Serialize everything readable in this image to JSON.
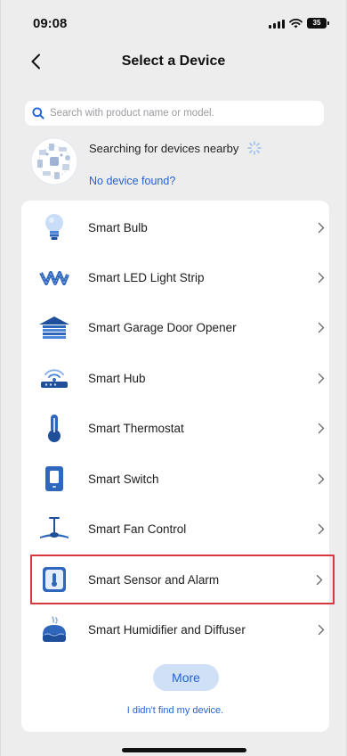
{
  "status_bar": {
    "time": "09:08",
    "battery": "35"
  },
  "nav": {
    "title": "Select a Device",
    "back_icon": "chevron-left-icon"
  },
  "search": {
    "placeholder": "Search with product name or model."
  },
  "nearby": {
    "status": "Searching for devices nearby",
    "not_found_link": "No device found?"
  },
  "devices": [
    {
      "label": "Smart Bulb",
      "icon": "bulb-icon"
    },
    {
      "label": "Smart LED Light Strip",
      "icon": "light-strip-icon"
    },
    {
      "label": "Smart Garage Door Opener",
      "icon": "garage-door-icon"
    },
    {
      "label": "Smart Hub",
      "icon": "hub-icon"
    },
    {
      "label": "Smart Thermostat",
      "icon": "thermostat-icon"
    },
    {
      "label": "Smart Switch",
      "icon": "switch-icon"
    },
    {
      "label": "Smart Fan Control",
      "icon": "fan-icon"
    },
    {
      "label": "Smart Sensor and Alarm",
      "icon": "sensor-icon",
      "highlighted": true
    },
    {
      "label": "Smart Humidifier and Diffuser",
      "icon": "humidifier-icon"
    }
  ],
  "more_button": "More",
  "didnt_find_link": "I didn't find my device.",
  "colors": {
    "accent": "#2463d6",
    "highlight_border": "#d9363e",
    "background": "#ededee"
  }
}
